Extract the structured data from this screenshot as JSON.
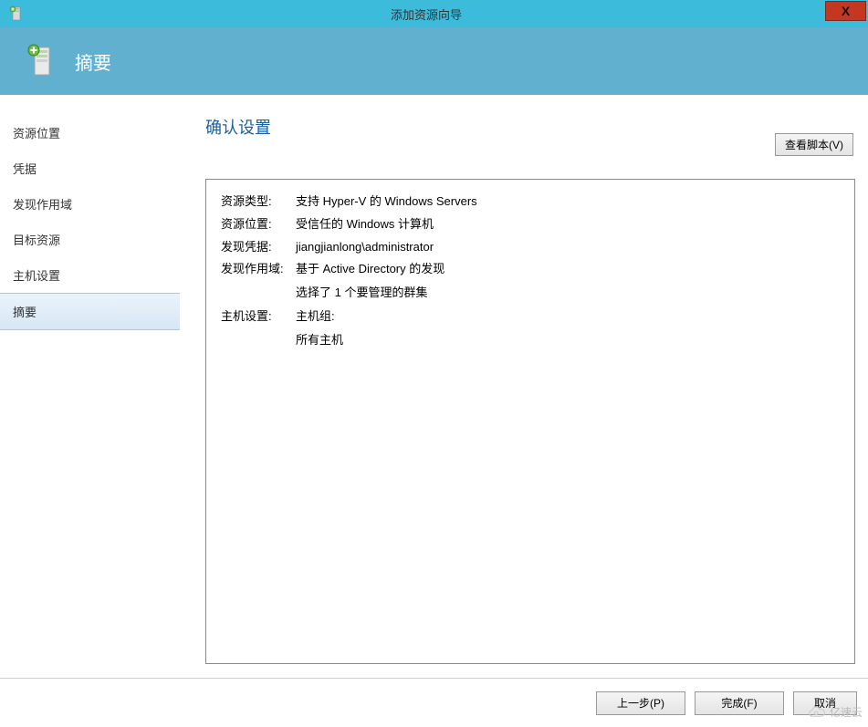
{
  "window": {
    "title": "添加资源向导",
    "close_label": "X"
  },
  "header": {
    "title": "摘要"
  },
  "sidebar": {
    "items": [
      {
        "label": "资源位置"
      },
      {
        "label": "凭据"
      },
      {
        "label": "发现作用域"
      },
      {
        "label": "目标资源"
      },
      {
        "label": "主机设置"
      },
      {
        "label": "摘要"
      }
    ],
    "selected_index": 5
  },
  "main": {
    "title": "确认设置",
    "script_button": "查看脚本(V)",
    "rows": [
      {
        "label": "资源类型:",
        "value": "支持 Hyper-V 的 Windows Servers"
      },
      {
        "label": "资源位置:",
        "value": "受信任的 Windows 计算机"
      },
      {
        "label": "发现凭据:",
        "value": "jiangjianlong\\administrator"
      },
      {
        "label": "发现作用域:",
        "value": "基于 Active Directory 的发现",
        "value2": "选择了 1 个要管理的群集"
      },
      {
        "label": "主机设置:",
        "value": "主机组:",
        "value2": "所有主机"
      }
    ]
  },
  "footer": {
    "previous": "上一步(P)",
    "finish": "完成(F)",
    "cancel": "取消"
  },
  "watermark": "亿速云"
}
